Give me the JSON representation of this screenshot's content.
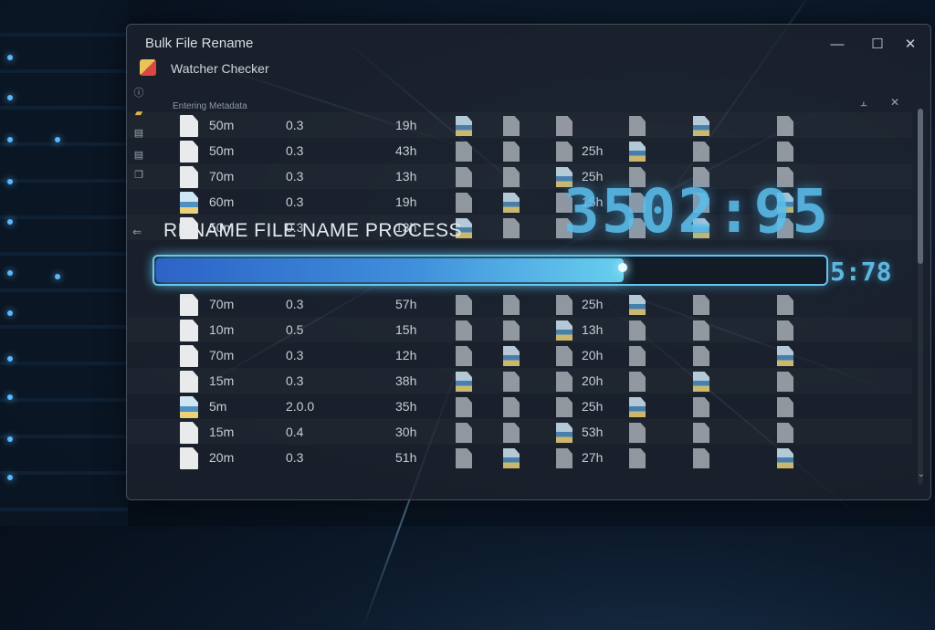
{
  "window": {
    "title": "Bulk File Rename",
    "subtitle": "Watcher Checker",
    "controls": {
      "minimize": "—",
      "maximize": "☐",
      "close": "✕"
    }
  },
  "panel": {
    "header": "Entering Metadata",
    "controls": {
      "pin": "⫠",
      "close": "✕"
    }
  },
  "process": {
    "label": "RENAME FILE NAME PROCESS",
    "progress_fraction": 0.7,
    "timer": "3502:95",
    "eta": "5:78"
  },
  "rows": [
    {
      "name": "50m",
      "ver": "0.3",
      "size": "19h",
      "pct": "",
      "pct2": "",
      "img": false
    },
    {
      "name": "50m",
      "ver": "0.3",
      "size": "43h",
      "pct": "25h",
      "pct2": "",
      "img": false
    },
    {
      "name": "70m",
      "ver": "0.3",
      "size": "13h",
      "pct": "25h",
      "pct2": "",
      "img": false
    },
    {
      "name": "60m",
      "ver": "0.3",
      "size": "19h",
      "pct": "15h",
      "pct2": "",
      "img": true
    },
    {
      "name": "50m",
      "ver": "0.3",
      "size": "13h",
      "pct": "",
      "pct2": "",
      "img": false
    },
    {
      "name": "70m",
      "ver": "0.3",
      "size": "57h",
      "pct": "25h",
      "pct2": "",
      "img": false
    },
    {
      "name": "10m",
      "ver": "0.5",
      "size": "15h",
      "pct": "13h",
      "pct2": "",
      "img": false
    },
    {
      "name": "70m",
      "ver": "0.3",
      "size": "12h",
      "pct": "20h",
      "pct2": "",
      "img": false
    },
    {
      "name": "15m",
      "ver": "0.3",
      "size": "38h",
      "pct": "20h",
      "pct2": "",
      "img": false
    },
    {
      "name": "5m",
      "ver": "2.0.0",
      "size": "35h",
      "pct": "25h",
      "pct2": "",
      "img": true
    },
    {
      "name": "15m",
      "ver": "0.4",
      "size": "30h",
      "pct": "53h",
      "pct2": "",
      "img": false
    },
    {
      "name": "20m",
      "ver": "0.3",
      "size": "51h",
      "pct": "27h",
      "pct2": "",
      "img": false
    }
  ],
  "side_icons": [
    "info-icon",
    "folder-icon",
    "document-icon",
    "document-icon",
    "copy-icon"
  ],
  "colors": {
    "accent": "#65c3ee",
    "fill_start": "#2c63c7",
    "fill_end": "#68d0ee"
  }
}
